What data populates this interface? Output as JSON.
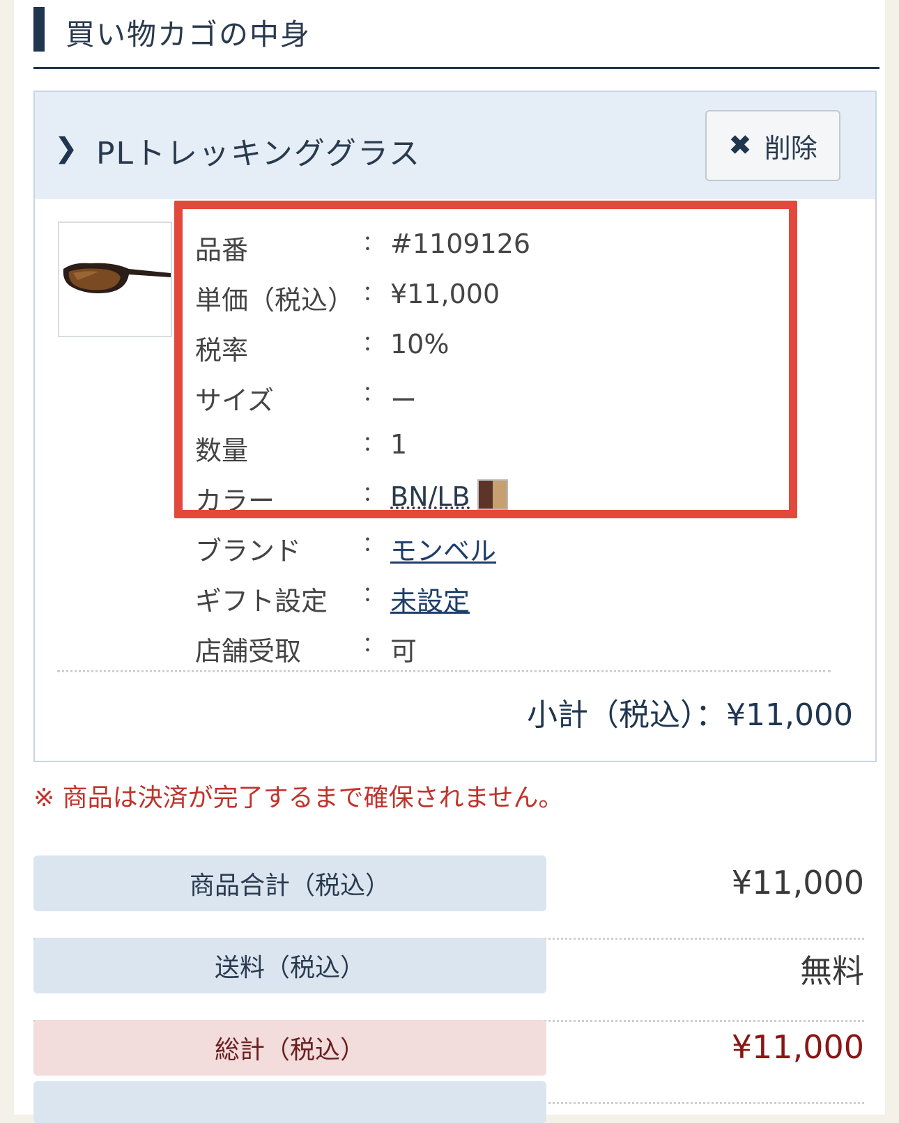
{
  "header": {
    "title": "買い物カゴの中身"
  },
  "item": {
    "name": "PLトレッキンググラス",
    "delete_label": "削除",
    "specs": [
      {
        "label": "品番",
        "value": "#1109126"
      },
      {
        "label": "単価（税込）",
        "value": "¥11,000"
      },
      {
        "label": "税率",
        "value": "10%"
      },
      {
        "label": "サイズ",
        "value": "ー"
      },
      {
        "label": "数量",
        "value": "1"
      },
      {
        "label": "カラー",
        "value": "BN/LB"
      },
      {
        "label": "ブランド",
        "value": "モンベル"
      },
      {
        "label": "ギフト設定",
        "value": "未設定"
      },
      {
        "label": "店舗受取",
        "value": "可"
      }
    ],
    "separator": "：",
    "subtotal": "小計（税込）：¥11,000",
    "color_swatch": [
      "#5e3328",
      "#c6a070"
    ]
  },
  "notice": "※ 商品は決済が完了するまで確保されません。",
  "summary": [
    {
      "label": "商品合計（税込）",
      "value": "¥11,000"
    },
    {
      "label": "送料（税込）",
      "value": "無料"
    },
    {
      "label": "総計（税込）",
      "value": "¥11,000"
    }
  ],
  "colors": {
    "accent": "#1f3550",
    "highlight": "#e2493c",
    "notice": "#c0332b"
  }
}
